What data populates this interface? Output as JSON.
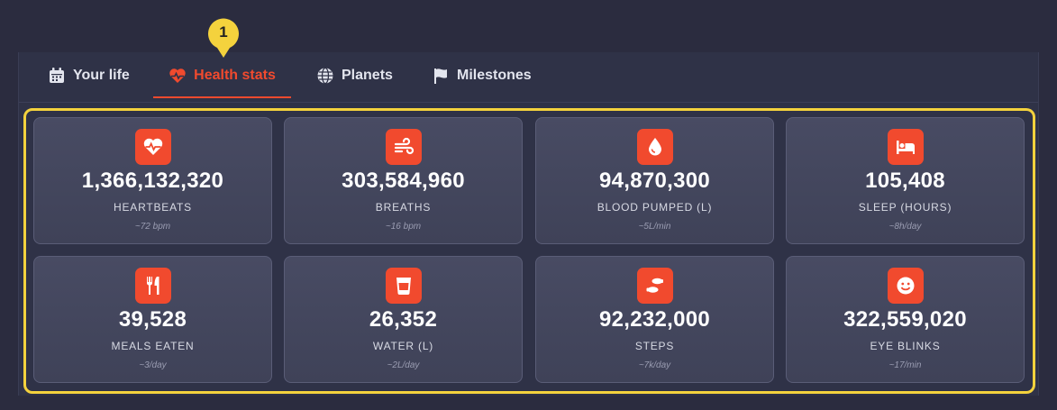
{
  "tabs": [
    {
      "label": "Your life",
      "icon": "calendar-icon"
    },
    {
      "label": "Health stats",
      "icon": "heartbeat-icon",
      "active": true
    },
    {
      "label": "Planets",
      "icon": "globe-icon"
    },
    {
      "label": "Milestones",
      "icon": "flag-icon"
    }
  ],
  "annotation": {
    "badge": "1"
  },
  "colors": {
    "accent": "#f14a2e",
    "highlight": "#f4d23d",
    "background": "#2b2c3f"
  },
  "stats": [
    {
      "value": "1,366,132,320",
      "label": "HEARTBEATS",
      "sub": "~72 bpm",
      "icon": "heartbeat-icon"
    },
    {
      "value": "303,584,960",
      "label": "BREATHS",
      "sub": "~16 bpm",
      "icon": "wind-icon"
    },
    {
      "value": "94,870,300",
      "label": "BLOOD PUMPED (L)",
      "sub": "~5L/min",
      "icon": "blood-drop-icon"
    },
    {
      "value": "105,408",
      "label": "SLEEP (HOURS)",
      "sub": "~8h/day",
      "icon": "bed-icon"
    },
    {
      "value": "39,528",
      "label": "MEALS EATEN",
      "sub": "~3/day",
      "icon": "utensils-icon"
    },
    {
      "value": "26,352",
      "label": "WATER (L)",
      "sub": "~2L/day",
      "icon": "glass-icon"
    },
    {
      "value": "92,232,000",
      "label": "STEPS",
      "sub": "~7k/day",
      "icon": "footprints-icon"
    },
    {
      "value": "322,559,020",
      "label": "EYE BLINKS",
      "sub": "~17/min",
      "icon": "smile-icon"
    }
  ]
}
